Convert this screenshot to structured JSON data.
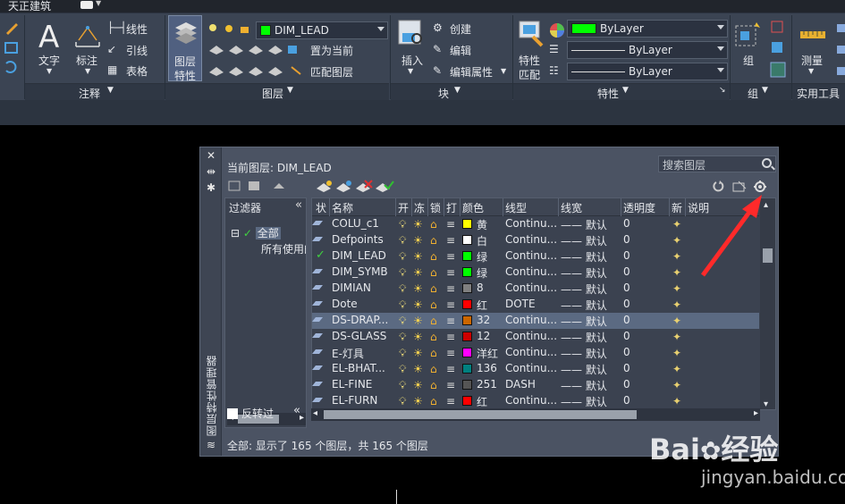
{
  "app": {
    "tab_label": "天正建筑"
  },
  "ribbon": {
    "annotation": {
      "text_label": "文字",
      "dim_label": "标注",
      "linear_label": "线性",
      "leader_label": "引线",
      "table_label": "表格",
      "group_title": "注释"
    },
    "layers": {
      "props_label_1": "图层",
      "props_label_2": "特性",
      "current_layer": "DIM_LEAD",
      "current_color": "#00ff00",
      "set_current_label": "置为当前",
      "match_layer_label": "匹配图层",
      "group_title": "图层"
    },
    "block": {
      "insert_label": "插入",
      "create_label": "创建",
      "edit_label": "编辑",
      "edit_attr_label": "编辑属性",
      "group_title": "块"
    },
    "properties": {
      "match_label_1": "特性",
      "match_label_2": "匹配",
      "color_value": "ByLayer",
      "color_swatch": "#00ff00",
      "lineweight_value": "ByLayer",
      "linetype_value": "ByLayer",
      "group_title": "特性"
    },
    "groups": {
      "group_label": "组",
      "group_title": "组"
    },
    "utilities": {
      "measure_label": "测量",
      "group_title": "实用工具"
    }
  },
  "palette": {
    "current_layer_label": "当前图层: DIM_LEAD",
    "search_placeholder": "搜索图层",
    "vertical_title": "图层特性管理器",
    "filter_title": "过滤器",
    "tree_all": "全部",
    "tree_used": "所有使用的图层",
    "invert_label": "反转过",
    "status": "全部: 显示了 165 个图层，共 165 个图层",
    "columns": [
      "状",
      "名称",
      "开",
      "冻",
      "锁",
      "打",
      "颜色",
      "线型",
      "线宽",
      "透明度",
      "新",
      "说明"
    ],
    "rows": [
      {
        "name": "COLU_c1",
        "color": "#ffff00",
        "color_name": "黄",
        "linetype": "Continu...",
        "lineweight": "—— 默认",
        "transparency": "0",
        "current": false,
        "selected": false
      },
      {
        "name": "Defpoints",
        "color": "#ffffff",
        "color_name": "白",
        "linetype": "Continu...",
        "lineweight": "—— 默认",
        "transparency": "0",
        "current": false,
        "selected": false
      },
      {
        "name": "DIM_LEAD",
        "color": "#00ff00",
        "color_name": "绿",
        "linetype": "Continu...",
        "lineweight": "—— 默认",
        "transparency": "0",
        "current": true,
        "selected": false
      },
      {
        "name": "DIM_SYMB",
        "color": "#00ff00",
        "color_name": "绿",
        "linetype": "Continu...",
        "lineweight": "—— 默认",
        "transparency": "0",
        "current": false,
        "selected": false
      },
      {
        "name": "DIMIAN",
        "color": "#808080",
        "color_name": "8",
        "linetype": "Continu...",
        "lineweight": "—— 默认",
        "transparency": "0",
        "current": false,
        "selected": false
      },
      {
        "name": "Dote",
        "color": "#ff0000",
        "color_name": "红",
        "linetype": "DOTE",
        "lineweight": "—— 默认",
        "transparency": "0",
        "current": false,
        "selected": false
      },
      {
        "name": "DS-DRAP...",
        "color": "#cc6600",
        "color_name": "32",
        "linetype": "Continu...",
        "lineweight": "—— 默认",
        "transparency": "0",
        "current": false,
        "selected": true
      },
      {
        "name": "DS-GLASS",
        "color": "#cc0000",
        "color_name": "12",
        "linetype": "Continu...",
        "lineweight": "—— 默认",
        "transparency": "0",
        "current": false,
        "selected": false
      },
      {
        "name": "E-灯具",
        "color": "#ff00ff",
        "color_name": "洋红",
        "linetype": "Continu...",
        "lineweight": "—— 默认",
        "transparency": "0",
        "current": false,
        "selected": false
      },
      {
        "name": "EL-BHAT...",
        "color": "#008080",
        "color_name": "136",
        "linetype": "Continu...",
        "lineweight": "—— 默认",
        "transparency": "0",
        "current": false,
        "selected": false
      },
      {
        "name": "EL-FINE",
        "color": "#555555",
        "color_name": "251",
        "linetype": "DASH",
        "lineweight": "—— 默认",
        "transparency": "0",
        "current": false,
        "selected": false
      },
      {
        "name": "EL-FURN",
        "color": "#ff0000",
        "color_name": "红",
        "linetype": "Continu...",
        "lineweight": "—— 默认",
        "transparency": "0",
        "current": false,
        "selected": false
      }
    ]
  },
  "watermark": {
    "brand": "Bai",
    "brand2": "经验",
    "url": "jingyan.baidu.com"
  }
}
